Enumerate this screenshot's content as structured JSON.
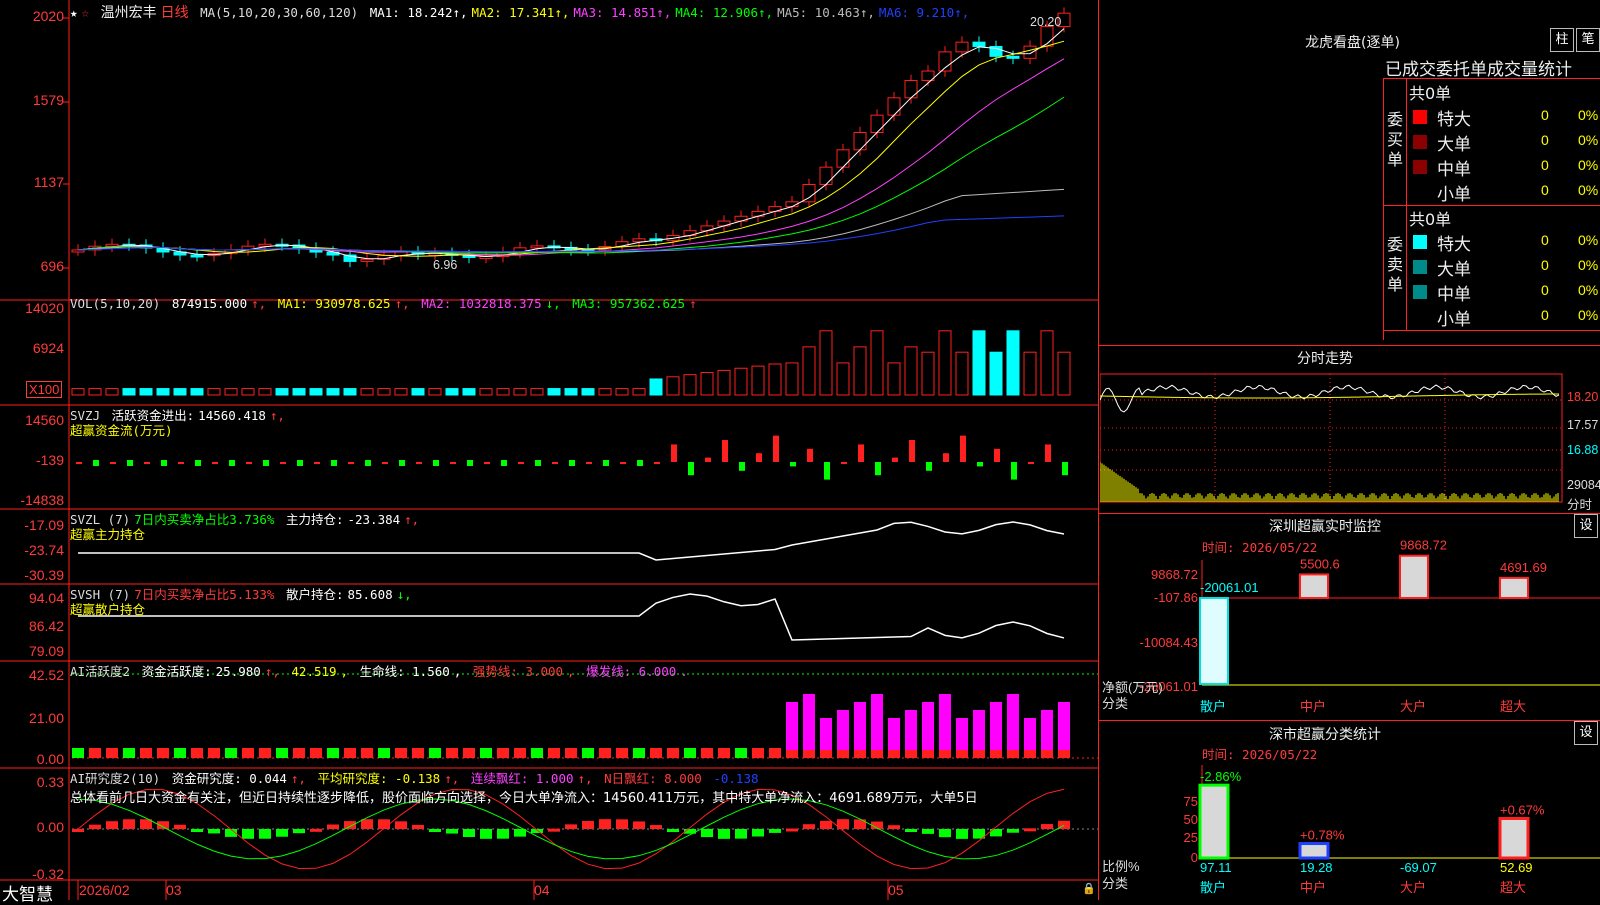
{
  "window": {
    "brand": "大智慧",
    "date_start": "2026/02"
  },
  "main": {
    "stock_name": "温州宏丰",
    "period": "日线",
    "ma_params": "MA(5,10,20,30,60,120)",
    "ma_values": [
      {
        "label": "MA1:",
        "value": "18.242",
        "color": "#ffffff"
      },
      {
        "label": "MA2:",
        "value": "17.341",
        "color": "#ffff00"
      },
      {
        "label": "MA3:",
        "value": "14.851",
        "color": "#ff40ff"
      },
      {
        "label": "MA4:",
        "value": "12.906",
        "color": "#00ff00"
      },
      {
        "label": "MA5:",
        "value": "10.463",
        "color": "#bbbbbb"
      },
      {
        "label": "MA6:",
        "value": "9.210",
        "color": "#2040ff"
      }
    ],
    "y_ticks": [
      "2020",
      "1579",
      "1137",
      "696"
    ],
    "high_label": "20.20",
    "low_label": "6.96"
  },
  "vol": {
    "params": "VOL(5,10,20)",
    "value": "874915.000",
    "ma1": "MA1: 930978.625",
    "ma2": "MA2: 1032818.375",
    "ma3": "MA3: 957362.625",
    "y_ticks": [
      "14020",
      "6924"
    ],
    "unit": "X100"
  },
  "svzj": {
    "title": "SVZJ",
    "label": "活跃资金进出:",
    "value": "14560.418",
    "sub": "超赢资金流(万元)",
    "y_ticks": [
      "14560",
      "-139",
      "-14838"
    ]
  },
  "svzl": {
    "title": "SVZL (7)",
    "label1": "7日内买卖净占比3.736%",
    "label2": "主力持仓:",
    "value": "-23.384",
    "sub": "超赢主力持仓",
    "y_ticks": [
      "-17.09",
      "-23.74",
      "-30.39"
    ]
  },
  "svsh": {
    "title": "SVSH (7)",
    "label1": "7日内买卖净占比5.133%",
    "label2": "散户持仓:",
    "value": "85.608",
    "sub": "超赢散户持仓",
    "y_ticks": [
      "94.04",
      "86.42",
      "79.09"
    ]
  },
  "ai1": {
    "title": "AI活跃度2",
    "label": "资金活跃度:",
    "value": "25.980",
    "v2": "42.519",
    "life": "生命线: 1.560",
    "strong": "强势线: 3.000",
    "burst": "爆发线: 6.000",
    "y_ticks": [
      "42.52",
      "21.00",
      "0.00"
    ]
  },
  "ai2": {
    "title": "AI研究度2(10)",
    "label": "资金研究度: 0.044",
    "avg": "平均研究度: -0.138",
    "red": "连续飘红: 1.000",
    "nred": "N日飘红: 8.000",
    "last": "-0.138",
    "summary": "总体看前几日大资金有关注，但近日持续性逐步降低，股价面临方向选择，今日大单净流入：14560.411万元，其中特大单净流入：4691.689万元，大单5日",
    "y_ticks": [
      "0.33",
      "0.00",
      "-0.32"
    ]
  },
  "x_labels": [
    "2026/02",
    "03",
    "04",
    "05"
  ],
  "side": {
    "longhu_title": "龙虎看盘(逐单)",
    "btn1": "柱",
    "btn2": "笔",
    "stat_title": "已成交委托单成交量统计",
    "buy_group": "委买单",
    "buy_total": "共0单",
    "sell_group": "委卖单",
    "sell_total": "共0单",
    "rows": [
      "特大",
      "大单",
      "中单",
      "小单"
    ],
    "zero": "0",
    "pct": "0%",
    "buy_colors": [
      "#ff0000",
      "#8b0000",
      "#8b0000",
      "#000000"
    ],
    "sell_colors": [
      "#00ffff",
      "#008b8b",
      "#008b8b",
      "#000000"
    ],
    "fs_title": "分时走势",
    "fs_ticks": [
      "18.20",
      "17.57",
      "16.88"
    ],
    "fs_vol": "29084",
    "fs_vol_label": "分时",
    "sz_title": "深圳超赢实时监控",
    "sz_btn": "设",
    "sz_time": "时间: 2026/05/22",
    "sz_ticks": [
      "9868.72",
      "-107.86",
      "-10084.43",
      "-20061.01"
    ],
    "sz_axis": "净额(万元)",
    "sz_cat_label": "分类",
    "sz_cats": [
      "散户",
      "中户",
      "大户",
      "超大"
    ],
    "sz_vals": [
      -20061.01,
      5500.6,
      9868.72,
      4691.69
    ],
    "sz_val_labels": [
      "-20061.01",
      "5500.6",
      "9868.72",
      "4691.69"
    ],
    "ss_title": "深市超赢分类统计",
    "ss_btn": "设",
    "ss_time": "时间: 2026/05/22",
    "ss_ticks": [
      "75",
      "50",
      "25",
      "0"
    ],
    "ss_axis": "比例%",
    "ss_cat_label": "分类",
    "ss_cats": [
      "散户",
      "中户",
      "大户",
      "超大"
    ],
    "ss_top": [
      "-2.86%",
      "+0.78%",
      "",
      "+0.67%"
    ],
    "ss_bottom": [
      "97.11",
      "19.28",
      "-69.07",
      "52.69"
    ],
    "ss_vals": [
      97.11,
      19.28,
      0,
      52.69
    ]
  }
}
